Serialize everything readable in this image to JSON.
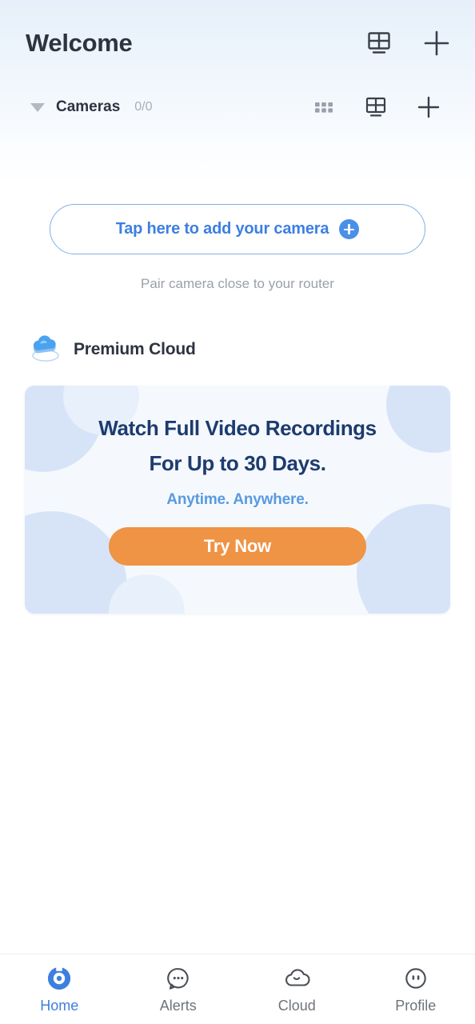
{
  "header": {
    "title": "Welcome",
    "grid_view_icon": "grid-view-icon",
    "add_icon": "plus-icon"
  },
  "cameras_section": {
    "collapse_icon": "caret-down-icon",
    "label": "Cameras",
    "count": "0/0",
    "dots_grid_icon": "dots-grid-icon",
    "grid_view_icon": "grid-view-icon",
    "add_icon": "plus-icon"
  },
  "add_camera": {
    "label": "Tap here to add your camera",
    "badge_icon": "plus-circle-icon",
    "hint": "Pair camera close to your router"
  },
  "premium": {
    "icon": "cloud-3d-icon",
    "title": "Premium Cloud"
  },
  "promo": {
    "headline_line1": "Watch Full Video Recordings",
    "headline_line2": "For Up to 30 Days.",
    "subtitle": "Anytime. Anywhere.",
    "cta_label": "Try Now"
  },
  "bottom_nav": {
    "items": [
      {
        "label": "Home",
        "icon": "camera-lens-icon",
        "active": true
      },
      {
        "label": "Alerts",
        "icon": "chat-bubble-icon",
        "active": false
      },
      {
        "label": "Cloud",
        "icon": "cloud-smile-icon",
        "active": false
      },
      {
        "label": "Profile",
        "icon": "face-circle-icon",
        "active": false
      }
    ]
  },
  "colors": {
    "accent_blue": "#3d7fe0",
    "badge_blue": "#4a90e8",
    "cta_orange": "#ef9344",
    "headline_navy": "#1d3b6e",
    "subtitle_blue": "#5a9ae0",
    "text_dark": "#2e3340",
    "text_muted": "#9ba0a8",
    "card_bg": "#f5f9fe",
    "blob_blue": "#d7e4f8"
  }
}
